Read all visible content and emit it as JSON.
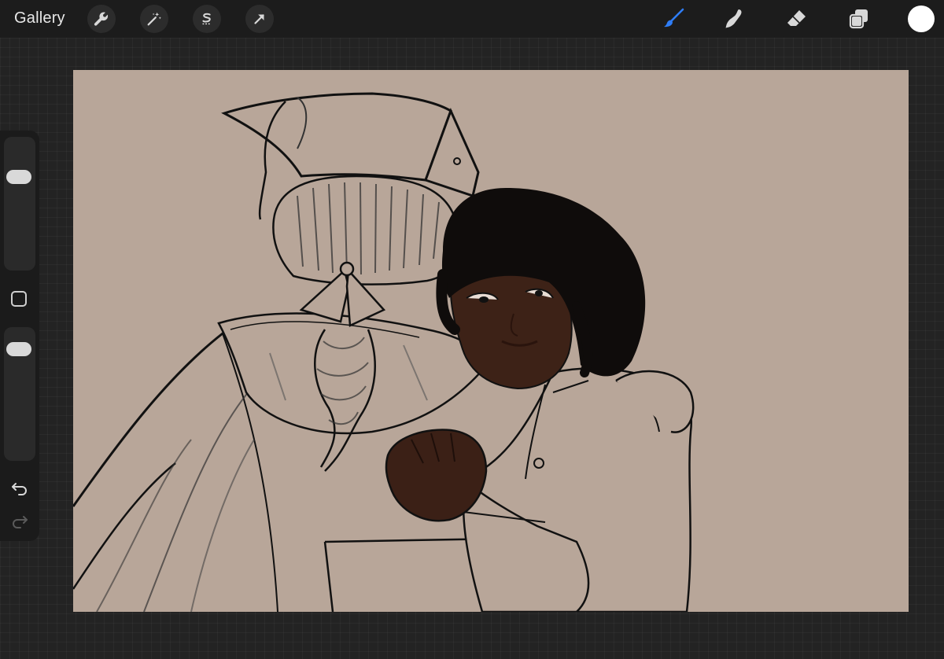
{
  "topbar": {
    "gallery_label": "Gallery",
    "left_tools": [
      {
        "name": "actions",
        "icon": "wrench-icon"
      },
      {
        "name": "adjustments",
        "icon": "magic-wand-icon"
      },
      {
        "name": "selection",
        "icon": "selection-s-icon"
      },
      {
        "name": "transform",
        "icon": "arrow-cursor-icon"
      }
    ],
    "right_tools": [
      {
        "name": "brush",
        "icon": "brush-icon",
        "active": true,
        "color": "#2f7df6"
      },
      {
        "name": "smudge",
        "icon": "smudge-finger-icon"
      },
      {
        "name": "eraser",
        "icon": "eraser-icon"
      },
      {
        "name": "layers",
        "icon": "layers-icon"
      }
    ],
    "current_color": "#ffffff"
  },
  "sidebar": {
    "brush_size_level": 0.74,
    "opacity_level": 0.91,
    "modify_icon": "square-icon",
    "undo_icon": "undo-icon",
    "redo_icon": "redo-icon"
  },
  "canvas": {
    "background_color": "#b8a699"
  }
}
